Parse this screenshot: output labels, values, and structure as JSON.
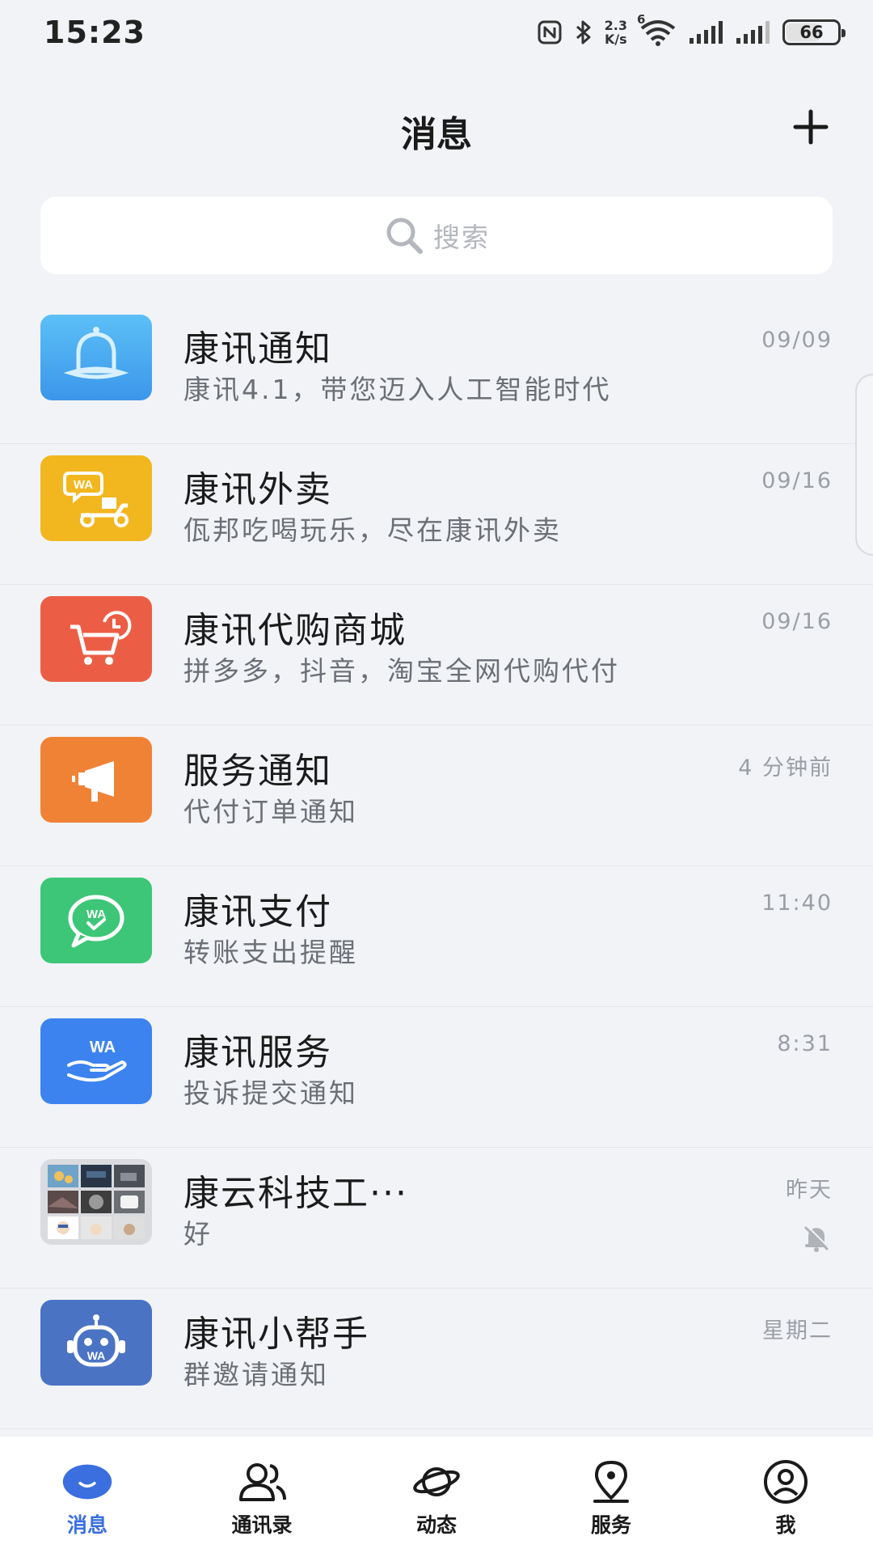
{
  "status_bar": {
    "time": "15:23",
    "net_speed_value": "2.3",
    "net_speed_unit": "K/s",
    "wifi_label": "6",
    "battery": "66",
    "battery_level": 0.66
  },
  "header": {
    "title": "消息",
    "add_icon": "plus-icon"
  },
  "search": {
    "placeholder": "搜索",
    "icon": "search-icon"
  },
  "chats": [
    {
      "title": "康讯通知",
      "preview": "康讯4.1，带您迈入人工智能时代",
      "time": "09/09",
      "icon": "bell-icon",
      "color": "#4aa8f0"
    },
    {
      "title": "康讯外卖",
      "preview": "佤邦吃喝玩乐，尽在康讯外卖",
      "time": "09/16",
      "icon": "delivery-scooter-icon",
      "color": "#f2b61f"
    },
    {
      "title": "康讯代购商城",
      "preview": "拼多多，抖音，淘宝全网代购代付",
      "time": "09/16",
      "icon": "shopping-cart-icon",
      "color": "#eb5e45"
    },
    {
      "title": "服务通知",
      "preview": "代付订单通知",
      "time": "4 分钟前",
      "icon": "megaphone-icon",
      "color": "#f08236"
    },
    {
      "title": "康讯支付",
      "preview": "转账支出提醒",
      "time": "11:40",
      "icon": "pay-chat-bubble-icon",
      "color": "#3dc677"
    },
    {
      "title": "康讯服务",
      "preview": "投诉提交通知",
      "time": "8:31",
      "icon": "hand-service-icon",
      "color": "#3c83ef"
    },
    {
      "title": "康云科技工···",
      "preview": "好",
      "time": "昨天",
      "icon": "group-photo-grid",
      "muted": true
    },
    {
      "title": "康讯小帮手",
      "preview": "群邀请通知",
      "time": "星期二",
      "icon": "robot-icon",
      "color": "#4a73c4"
    }
  ],
  "tabs": [
    {
      "label": "消息",
      "icon": "chat-bubble-icon",
      "active": true
    },
    {
      "label": "通讯录",
      "icon": "contacts-icon"
    },
    {
      "label": "动态",
      "icon": "planet-icon"
    },
    {
      "label": "服务",
      "icon": "location-pin-icon"
    },
    {
      "label": "我",
      "icon": "user-icon"
    }
  ],
  "colors": {
    "accent": "#3b6fe0",
    "background": "#f1f3f6"
  }
}
